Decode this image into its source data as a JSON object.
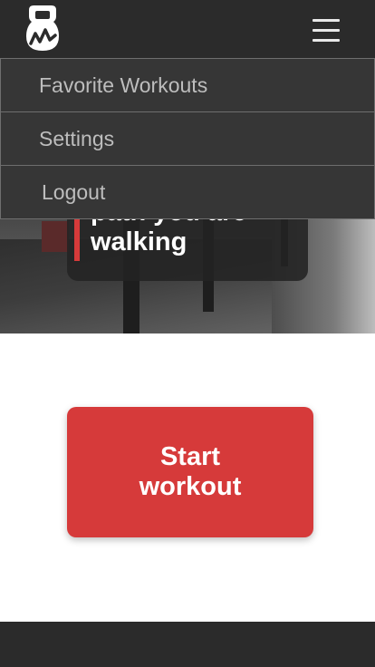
{
  "header": {
    "logo_icon": "kettlebell-logo-icon",
    "menu_icon": "hamburger-menu-icon"
  },
  "hero": {
    "quote_visible": "path you are\nwalking",
    "accent_color": "#d63a3a"
  },
  "menu": {
    "items": [
      {
        "label": "Favorite Workouts"
      },
      {
        "label": "Settings"
      },
      {
        "label": "Logout"
      }
    ]
  },
  "cta": {
    "label": "Start\nworkout",
    "color": "#d63a3a"
  }
}
